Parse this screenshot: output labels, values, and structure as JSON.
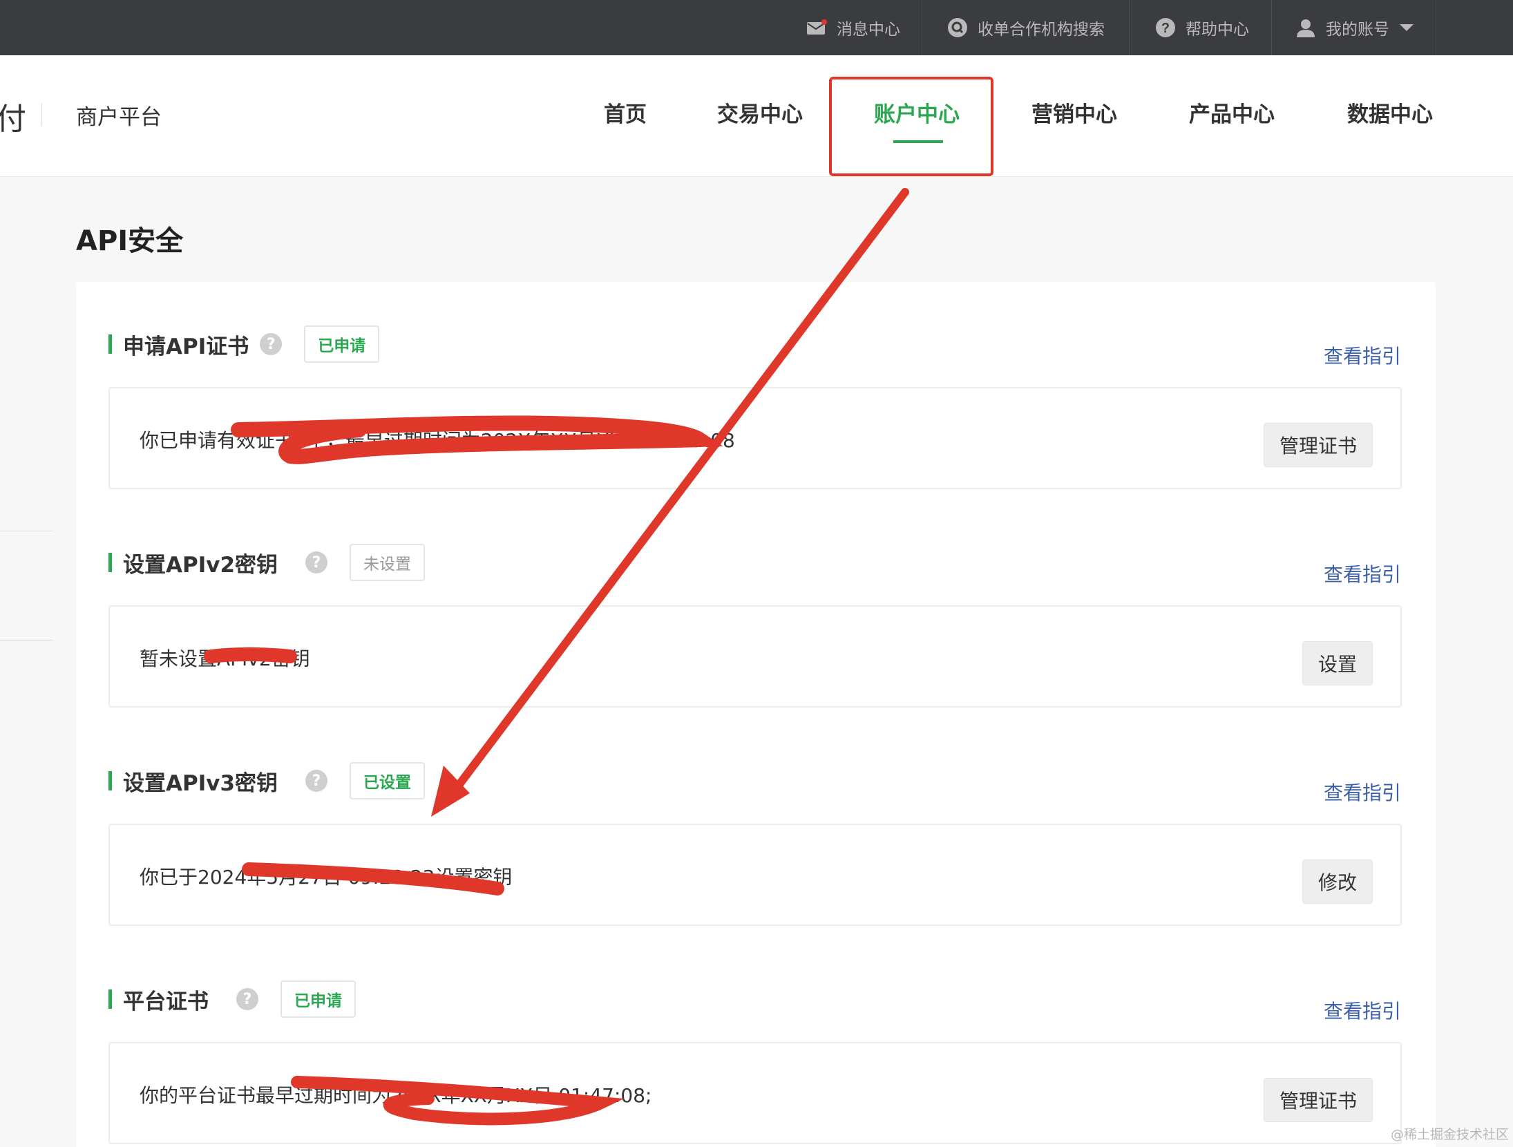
{
  "topbar": {
    "items": [
      {
        "label": "消息中心",
        "icon": "mail-icon",
        "has_dot": true
      },
      {
        "label": "收单合作机构搜索",
        "icon": "search-circle-icon"
      },
      {
        "label": "帮助中心",
        "icon": "question-circle-icon"
      },
      {
        "label": "我的账号",
        "icon": "user-icon",
        "dropdown_icon": "caret-down-icon"
      }
    ]
  },
  "header": {
    "logo_fragment": "付",
    "platform_name": "商户平台",
    "nav": [
      {
        "label": "首页"
      },
      {
        "label": "交易中心"
      },
      {
        "label": "账户中心",
        "active": true
      },
      {
        "label": "营销中心"
      },
      {
        "label": "产品中心"
      },
      {
        "label": "数据中心"
      }
    ]
  },
  "page": {
    "title": "API安全",
    "sections": [
      {
        "title": "申请API证书",
        "status": "已申请",
        "status_color": "#2ba84f",
        "guide_link": "查看指引",
        "content": "你已申请有效证书1个，最早过期时间为202X年XX月XX日 01:47:08",
        "button": "管理证书"
      },
      {
        "title": "设置APIv2密钥",
        "status": "未设置",
        "status_color": "#999999",
        "guide_link": "查看指引",
        "content": "暂未设置APIv2密钥",
        "button": "设置"
      },
      {
        "title": "设置APIv3密钥",
        "status": "已设置",
        "status_color": "#2ba84f",
        "guide_link": "查看指引",
        "content": "你已于2024年5月27日 09:28:23设置密钥",
        "button": "修改"
      },
      {
        "title": "平台证书",
        "status": "已申请",
        "status_color": "#2ba84f",
        "guide_link": "查看指引",
        "content": "你的平台证书最早过期时间为202X年XX月XX日 01:47:08;",
        "button": "管理证书"
      }
    ]
  },
  "colors": {
    "accent_green": "#2ba84f",
    "annotation_red": "#e0372b",
    "link_blue": "#3a5fa8",
    "topbar_bg": "#3b3c3f"
  },
  "watermark": "@稀土掘金技术社区"
}
